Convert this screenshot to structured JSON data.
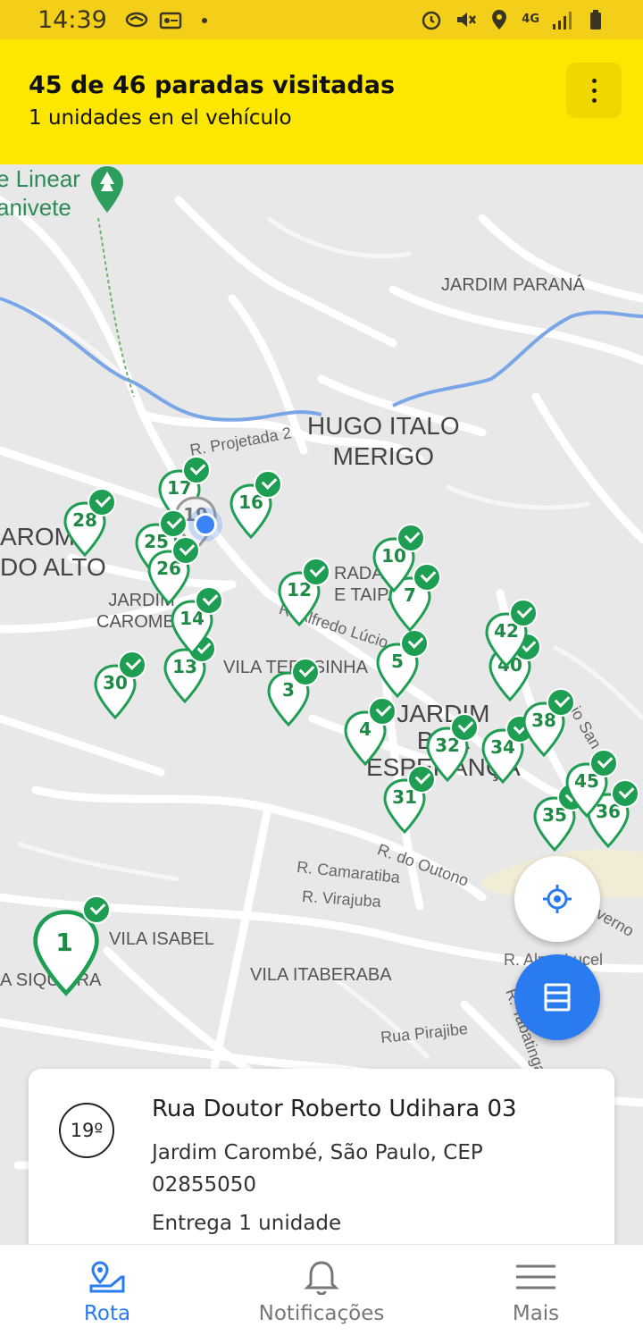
{
  "status_bar": {
    "time": "14:39",
    "network": "4G",
    "icons": [
      "handshake-icon",
      "key-card-icon",
      "dot-icon",
      "alarm-icon",
      "mute-icon",
      "location-icon",
      "signal-icon",
      "battery-icon"
    ]
  },
  "header": {
    "title": "45 de 46 paradas visitadas",
    "subtitle": "1 unidades en el vehículo",
    "menu_icon": "more-vert-icon"
  },
  "map": {
    "labels": {
      "park": "e Linear\nanivete",
      "jardim_parana": "JARDIM PARANÁ",
      "hugo_italo": "HUGO ITALO\nMERIGO",
      "projetada": "R. Projetada 2",
      "carombe_alto": "AROMB\nDO ALTO",
      "jardim_carombe": "JARDIM\nCAROMBE",
      "vila_teresinha": "VILA TERESINHA",
      "alfredo": "R. Alfredo Lúcio",
      "rada_taipa": "RADA\nE TAIPA",
      "jardim_esperanca": "JARDIM\nBOA\nESPERANÇA",
      "camaratiba": "R. Camaratiba",
      "virajuba": "R. Virajuba",
      "outono": "R. do Outono",
      "vila_isabel": "VILA ISABEL",
      "siqueira": "A SIQUEIRA",
      "vila_itaberaba": "VILA ITABERABA",
      "pirajibe": "Rua Pirajibe",
      "alma": "R. Alma Lucel",
      "tabatinga": "R. Tabatinga",
      "verno": "verno",
      "sano": "io San"
    },
    "pins": [
      "1",
      "3",
      "4",
      "5",
      "7",
      "10",
      "12",
      "13",
      "14",
      "16",
      "17",
      "19",
      "25",
      "26",
      "28",
      "30",
      "31",
      "32",
      "34",
      "35",
      "36",
      "38",
      "40",
      "42",
      "45"
    ],
    "current_stop": "19"
  },
  "fab": {
    "locate_icon": "my-location-icon",
    "list_icon": "list-icon"
  },
  "card": {
    "stop_number": "19º",
    "street": "Rua Doutor Roberto Udihara 03",
    "address_line": "Jardim Carombé, São Paulo, CEP 02855050",
    "units": "Entrega 1 unidade"
  },
  "bottom_nav": {
    "items": [
      {
        "label": "Rota",
        "icon": "route-map-icon"
      },
      {
        "label": "Notificações",
        "icon": "bell-icon"
      },
      {
        "label": "Mais",
        "icon": "menu-icon"
      }
    ]
  },
  "colors": {
    "status_bar": "#f3cf1a",
    "header": "#fde600",
    "pin_green": "#1e9e52",
    "accent_blue": "#2b7bf0"
  }
}
